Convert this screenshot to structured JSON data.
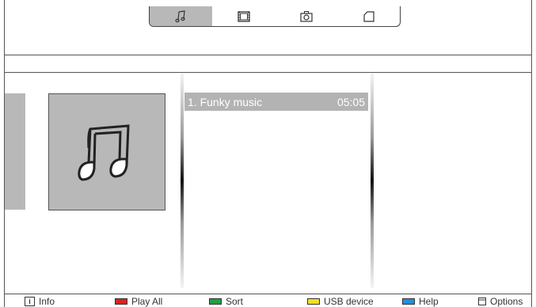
{
  "media_tabs": [
    {
      "name": "music",
      "icon": "music-note-icon",
      "active": true
    },
    {
      "name": "video",
      "icon": "film-icon",
      "active": false
    },
    {
      "name": "photo",
      "icon": "camera-icon",
      "active": false
    },
    {
      "name": "folder",
      "icon": "folder-icon",
      "active": false
    }
  ],
  "track_list": [
    {
      "title": "1. Funky music",
      "duration": "05:05",
      "selected": true
    }
  ],
  "bottom_bar": {
    "info_label": "Info",
    "play_all_label": "Play All",
    "sort_label": "Sort",
    "usb_label": "USB device",
    "help_label": "Help",
    "options_label": "Options"
  },
  "colors": {
    "red_key": "#e02020",
    "green_key": "#20a040",
    "yellow_key": "#f0e020",
    "blue_key": "#2090e0",
    "selected_bg": "#b3b3b3"
  }
}
